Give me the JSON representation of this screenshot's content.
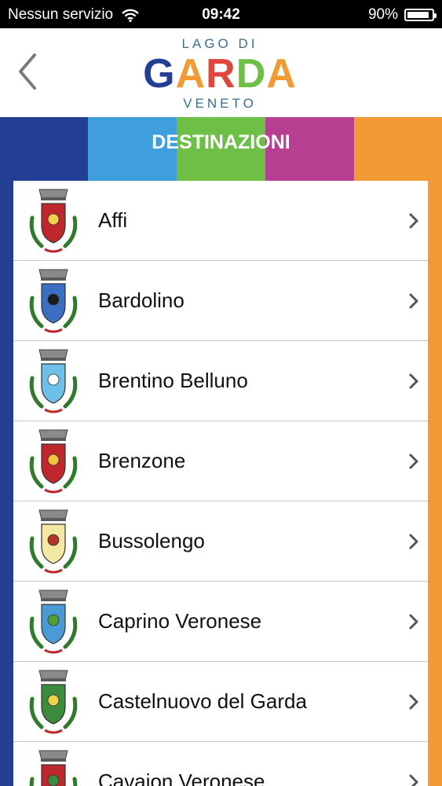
{
  "status_bar": {
    "carrier": "Nessun servizio",
    "time": "09:42",
    "battery": "90%",
    "battery_level": 0.9
  },
  "navbar": {
    "back_icon": "chevron-left-icon",
    "logo": {
      "top": "LAGO DI",
      "main": "GARDA",
      "bottom": "VENETO"
    }
  },
  "header": {
    "title": "DESTINAZIONI",
    "stripe_colors": [
      "#233f94",
      "#3f9fdd",
      "#6dbf45",
      "#b63f91",
      "#f29a34"
    ]
  },
  "destinations": [
    {
      "name": "Affi",
      "shield": "#c0272d",
      "accent": "#f2d24b"
    },
    {
      "name": "Bardolino",
      "shield": "#3a6fc4",
      "accent": "#1b1b1b"
    },
    {
      "name": "Brentino Belluno",
      "shield": "#6fc0e8",
      "accent": "#ffffff"
    },
    {
      "name": "Brenzone",
      "shield": "#c0272d",
      "accent": "#f2c33b"
    },
    {
      "name": "Bussolengo",
      "shield": "#f4e7a1",
      "accent": "#b0342a"
    },
    {
      "name": "Caprino Veronese",
      "shield": "#4a9ad6",
      "accent": "#4f9e35"
    },
    {
      "name": "Castelnuovo del Garda",
      "shield": "#3b8a3d",
      "accent": "#f2d24b"
    },
    {
      "name": "Cavaion Veronese",
      "shield": "#c0272d",
      "accent": "#3b8a3d"
    }
  ]
}
